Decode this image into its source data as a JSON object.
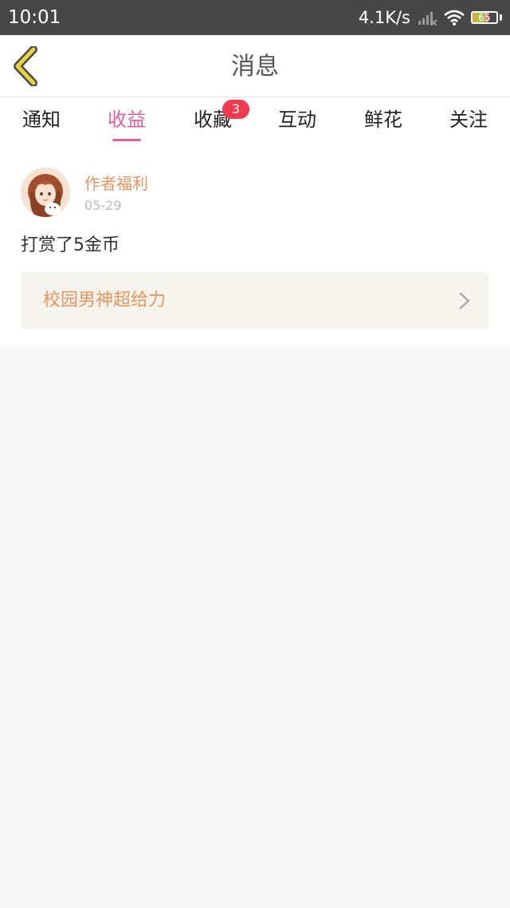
{
  "status_bar": {
    "time": "10:01",
    "network_speed": "4.1K/s",
    "battery_level": "65"
  },
  "header": {
    "title": "消息"
  },
  "tabs": [
    {
      "label": "通知",
      "active": false
    },
    {
      "label": "收益",
      "active": true
    },
    {
      "label": "收藏",
      "active": false,
      "badge": "3"
    },
    {
      "label": "互动",
      "active": false
    },
    {
      "label": "鲜花",
      "active": false
    },
    {
      "label": "关注",
      "active": false
    }
  ],
  "message": {
    "sender": "作者福利",
    "date": "05-29",
    "text": "打赏了5金币",
    "book_title": "校园男神超给力"
  },
  "colors": {
    "accent": "#e0609c",
    "sender": "#e8945a",
    "badge": "#f2394e",
    "status_bar": "#474747",
    "back_arrow": "#e8d23a"
  }
}
